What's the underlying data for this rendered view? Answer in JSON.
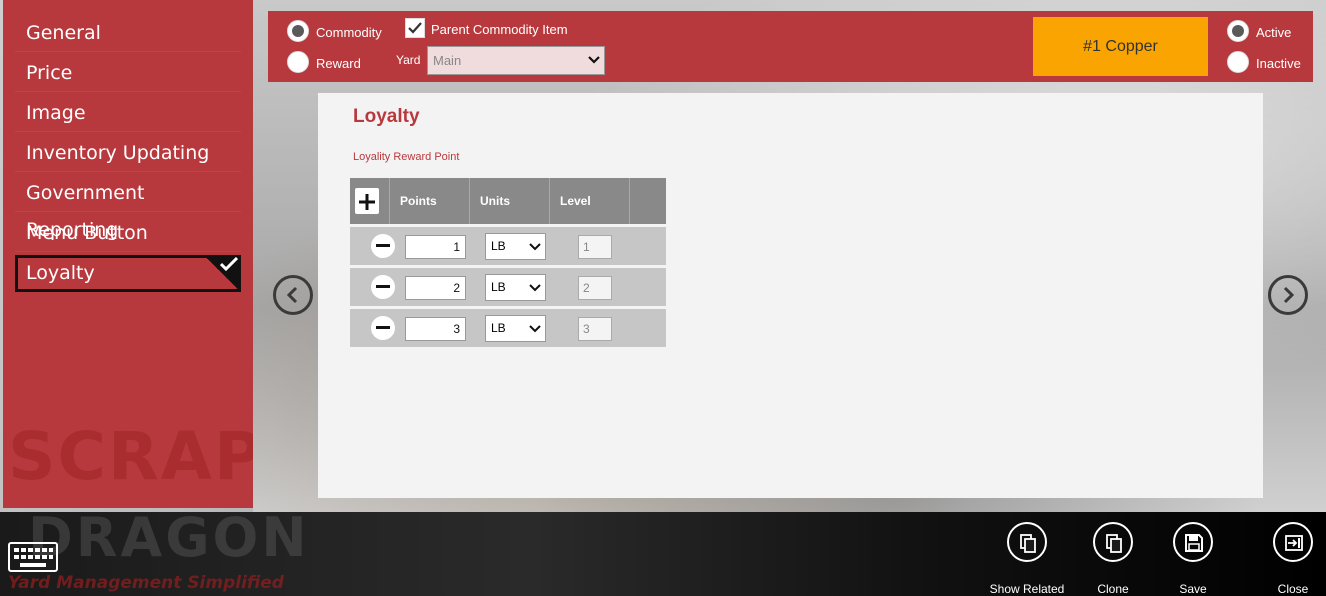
{
  "sidebar": {
    "items": [
      {
        "label": "General"
      },
      {
        "label": "Price"
      },
      {
        "label": "Image"
      },
      {
        "label": "Inventory Updating"
      },
      {
        "label": "Government Reporting"
      },
      {
        "label": "Menu Button"
      },
      {
        "label": "Loyalty",
        "selected": true
      }
    ],
    "watermark": "SCRAP"
  },
  "topbar": {
    "type_options": [
      {
        "label": "Commodity",
        "checked": true
      },
      {
        "label": "Reward",
        "checked": false
      }
    ],
    "parent_commodity": {
      "label": "Parent Commodity Item",
      "checked": true
    },
    "yard": {
      "label": "Yard",
      "value": "Main"
    },
    "commodity_button": "#1 Copper",
    "status_options": [
      {
        "label": "Active",
        "checked": true
      },
      {
        "label": "Inactive",
        "checked": false
      }
    ],
    "colors": {
      "accent": "#b8393d",
      "button": "#f9a400"
    }
  },
  "panel": {
    "title": "Loyalty",
    "subtitle": "Loyality Reward Point",
    "grid": {
      "headers": [
        "Points",
        "Units",
        "Level"
      ],
      "rows": [
        {
          "points": "1",
          "units": "LB",
          "level": "1"
        },
        {
          "points": "2",
          "units": "LB",
          "level": "2"
        },
        {
          "points": "3",
          "units": "LB",
          "level": "3"
        }
      ]
    }
  },
  "bottombar": {
    "logo": "DRAGON",
    "tagline": "Yard Management Simplified",
    "actions": [
      {
        "label": "Show Related",
        "icon": "copy-icon"
      },
      {
        "label": "Clone",
        "icon": "copy-icon"
      },
      {
        "label": "Save",
        "icon": "save-icon"
      },
      {
        "label": "Close",
        "icon": "exit-icon"
      }
    ]
  }
}
